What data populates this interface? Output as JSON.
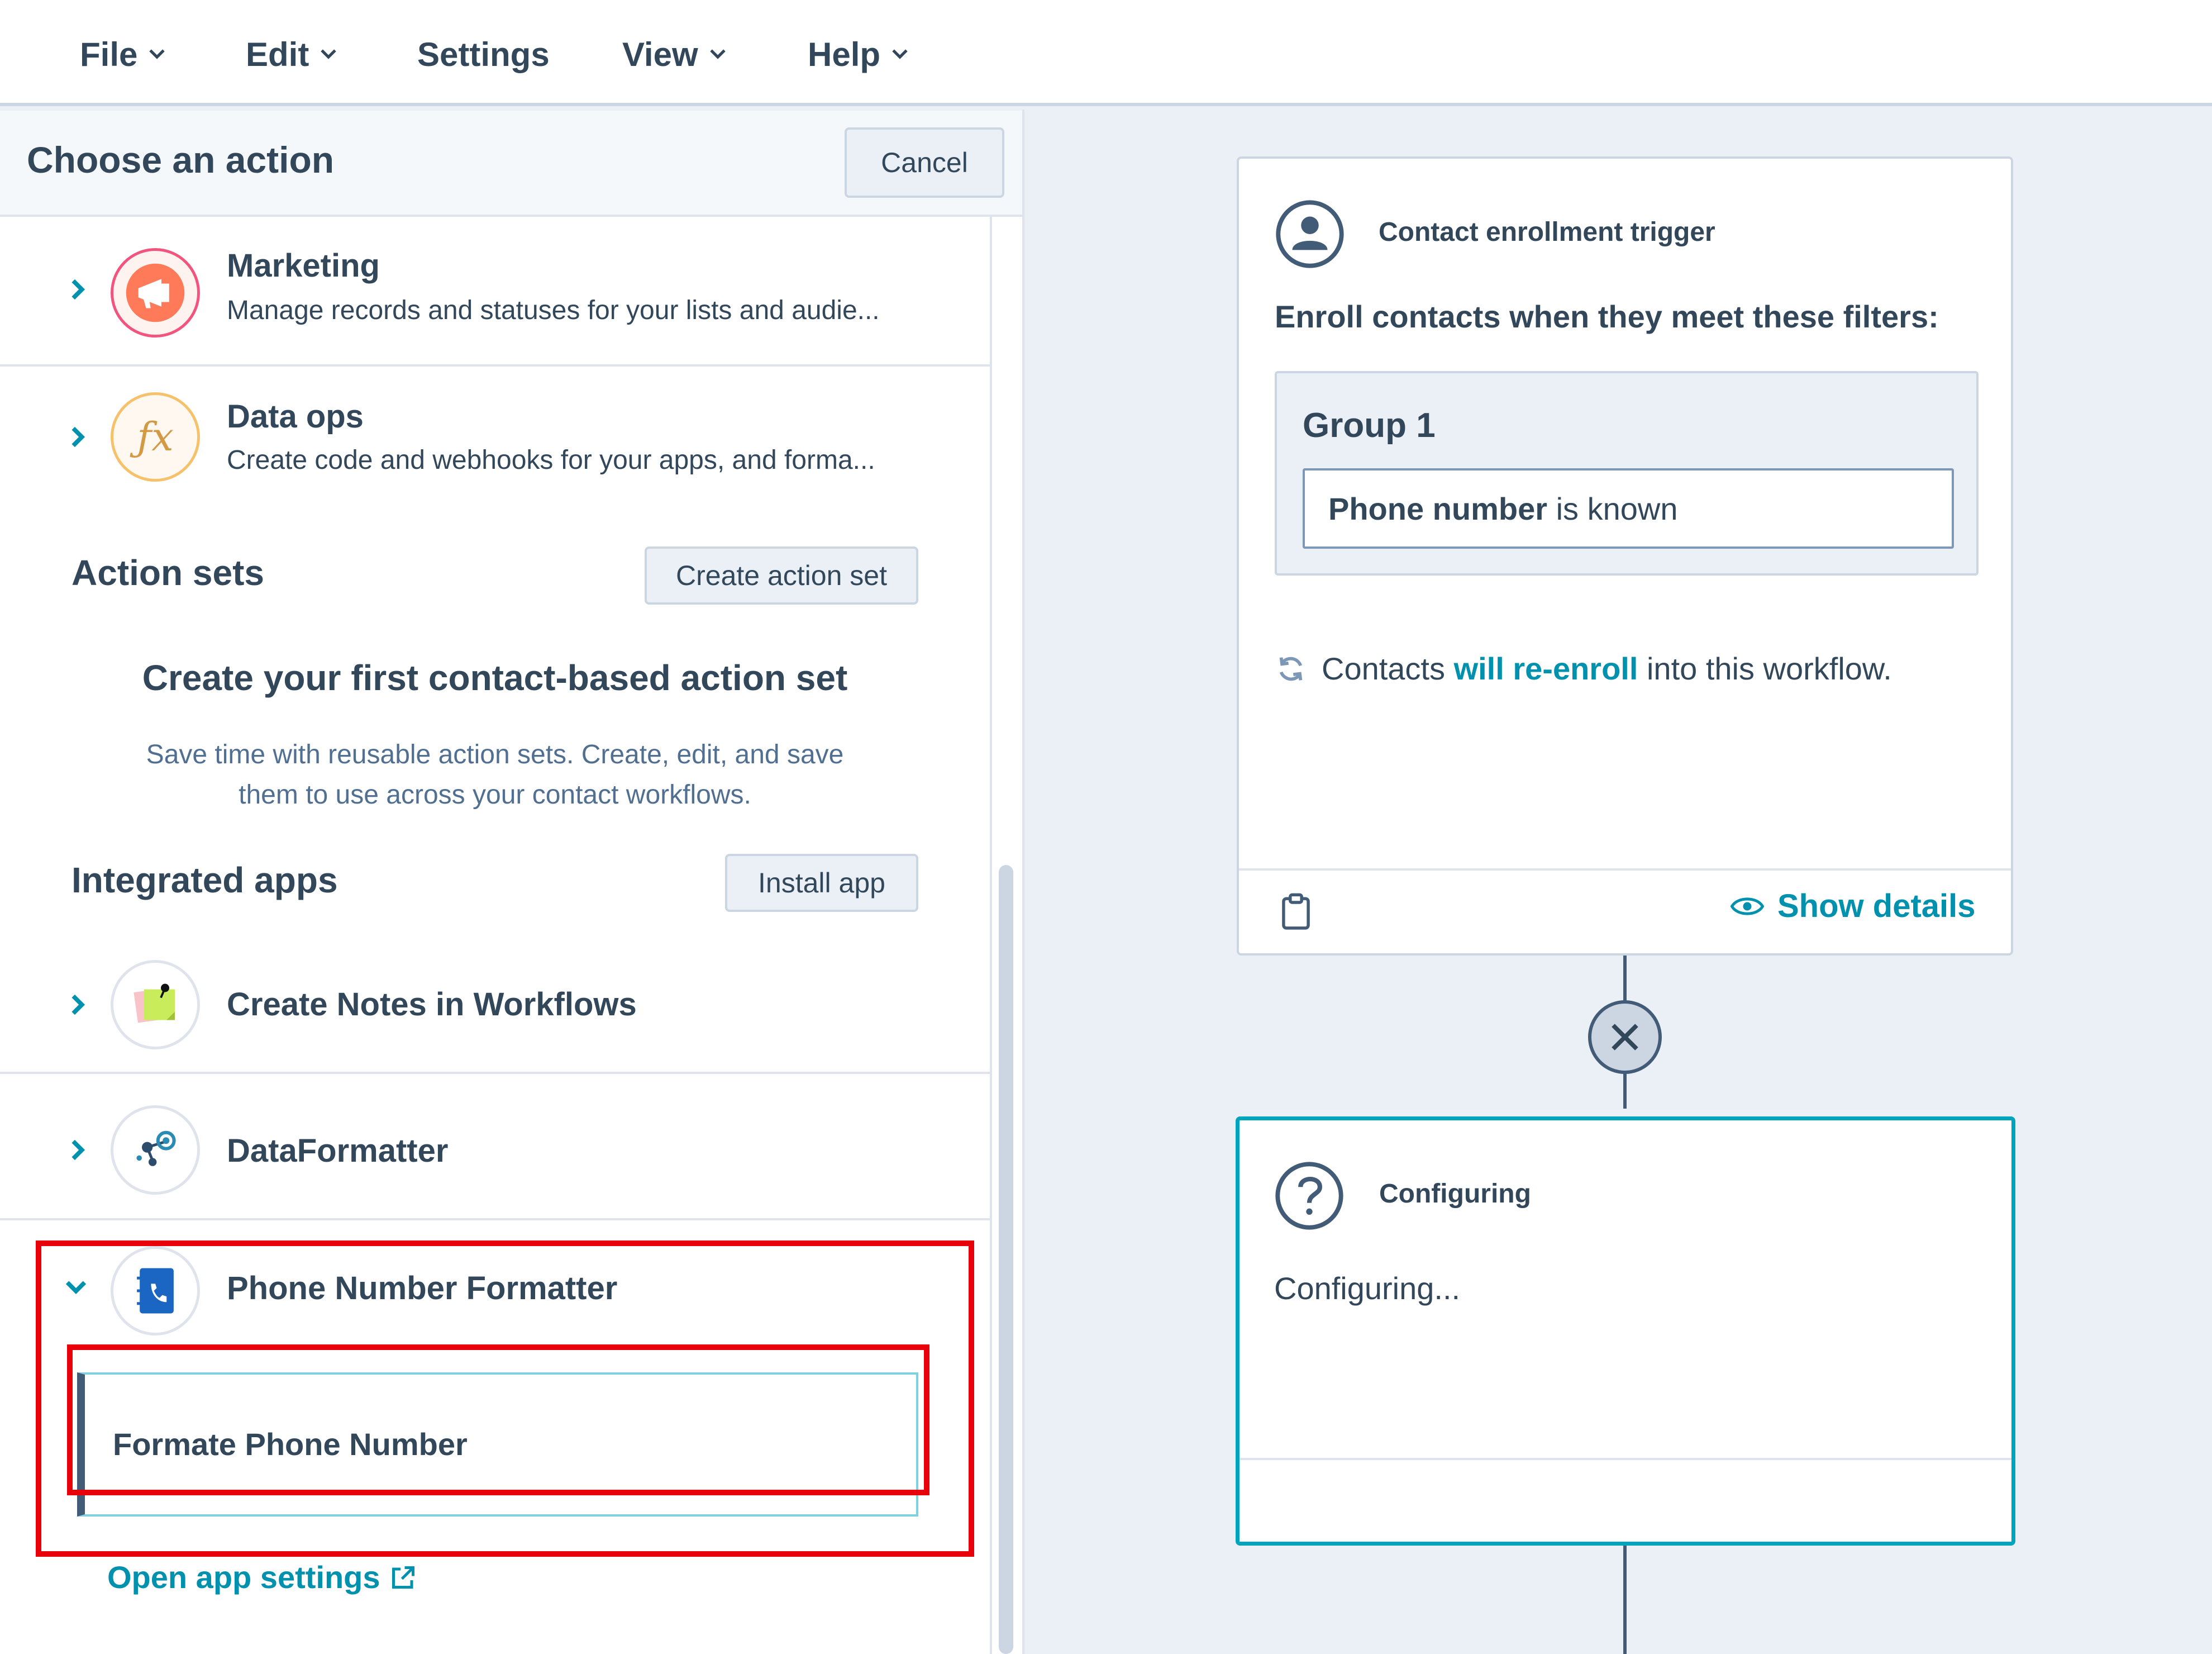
{
  "menu": {
    "file": "File",
    "edit": "Edit",
    "settings": "Settings",
    "view": "View",
    "help": "Help"
  },
  "panel": {
    "title": "Choose an action",
    "cancel": "Cancel"
  },
  "categories": [
    {
      "title": "Marketing",
      "description": "Manage records and statuses for your lists and audie...",
      "icon": "megaphone-icon"
    },
    {
      "title": "Data ops",
      "description": "Create code and webhooks for your apps, and forma...",
      "icon": "function-icon"
    }
  ],
  "action_sets": {
    "title": "Action sets",
    "create_button": "Create action set",
    "empty_title": "Create your first contact-based action set",
    "empty_line1": "Save time with reusable action sets. Create, edit, and save",
    "empty_line2": "them to use across your contact workflows."
  },
  "integrated_apps": {
    "title": "Integrated apps",
    "install_button": "Install app",
    "apps": [
      {
        "name": "Create Notes in Workflows",
        "icon": "sticky-note-icon",
        "expanded": false
      },
      {
        "name": "DataFormatter",
        "icon": "data-nodes-icon",
        "expanded": false
      },
      {
        "name": "Phone Number Formatter",
        "icon": "phone-book-icon",
        "expanded": true
      }
    ],
    "action": "Formate Phone Number",
    "settings_link": "Open app settings"
  },
  "trigger_card": {
    "label": "Contact enrollment trigger",
    "heading": "Enroll contacts when they meet these filters:",
    "group_title": "Group 1",
    "filter_property": "Phone number",
    "filter_condition": " is known",
    "reenroll_prefix": "Contacts ",
    "reenroll_link": "will re-enroll",
    "reenroll_suffix": " into this workflow.",
    "show_details": "Show details"
  },
  "config_card": {
    "label": "Configuring",
    "body": "Configuring..."
  },
  "colors": {
    "accent": "#0091ae",
    "text": "#33475b",
    "highlight": "#e8000b",
    "selected_border": "#00a4bd"
  }
}
